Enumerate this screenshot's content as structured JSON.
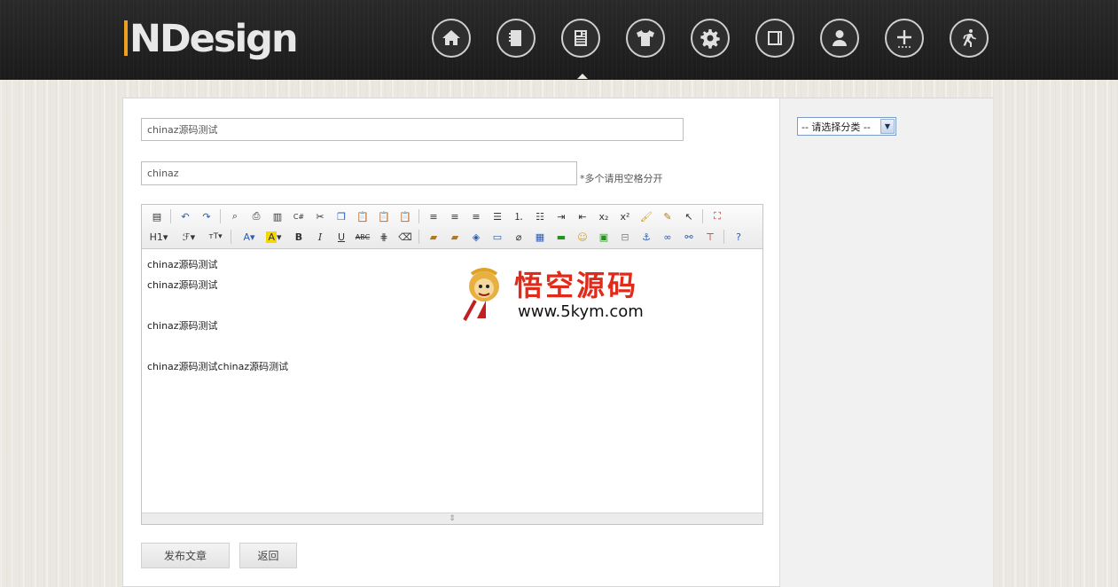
{
  "header": {
    "logo_text": "NDesign",
    "nav": [
      {
        "icon": "home-icon"
      },
      {
        "icon": "notebook-icon"
      },
      {
        "icon": "article-icon",
        "active": true
      },
      {
        "icon": "shirt-icon"
      },
      {
        "icon": "gear-icon"
      },
      {
        "icon": "layout-icon"
      },
      {
        "icon": "user-icon"
      },
      {
        "icon": "add-more-icon"
      },
      {
        "icon": "run-icon"
      }
    ]
  },
  "form": {
    "title_value": "chinaz源码测试",
    "tags_value": "chinaz",
    "tags_hint": "*多个请用空格分开",
    "category_selected": "-- 请选择分类 --"
  },
  "editor": {
    "toolbar_row1": [
      "source",
      "undo",
      "redo",
      "preview",
      "print",
      "template",
      "code",
      "cut",
      "copy",
      "paste",
      "paste-text",
      "paste-word",
      "justify-left",
      "justify-center",
      "justify-right",
      "justify-full",
      "ordered-list",
      "unordered-list",
      "indent",
      "outdent",
      "subscript",
      "superscript",
      "clear-format",
      "select-all",
      "fullscreen"
    ],
    "toolbar_row2_labels": {
      "heading": "H1",
      "font": "ℱ",
      "size": "тT",
      "forecolor": "A",
      "bgcolor": "A",
      "bold": "B",
      "italic": "I",
      "underline": "U",
      "strike": "ABC"
    },
    "content_lines": [
      "chinaz源码测试",
      "chinaz源码测试",
      "",
      "chinaz源码测试",
      "",
      "chinaz源码测试chinaz源码测试"
    ],
    "watermark_title": "悟空源码",
    "watermark_url": "www.5kym.com"
  },
  "buttons": {
    "publish": "发布文章",
    "back": "返回"
  }
}
